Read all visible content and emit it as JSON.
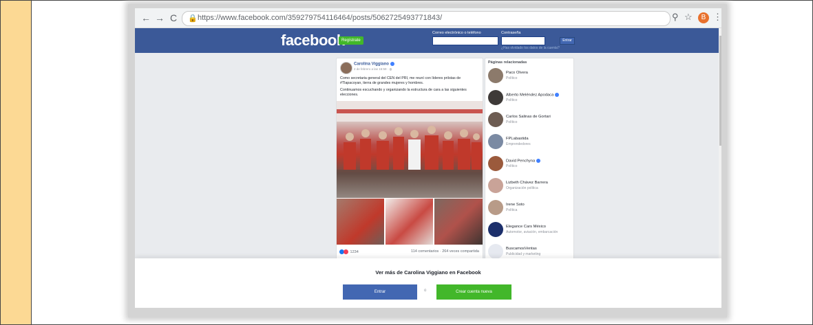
{
  "browser": {
    "url": "https://www.facebook.com/359279754116464/posts/5062725493771843/",
    "profile_initial": "B"
  },
  "facebook": {
    "logo": "facebook",
    "register_label": "Regístrate",
    "email_label": "Correo electrónico o teléfono",
    "password_label": "Contraseña",
    "login_label": "Entrar",
    "forgot_label": "¿Has olvidado los datos de la cuenta?"
  },
  "post": {
    "author": "Carolina Viggiano",
    "date": "2 de febrero a las 15:59 · ",
    "text_1": "Como secretaria general del CEN del PRI, me reuní con líderes priístas de #Tlapacoyan, tierra de grandes mujeres y hombres.",
    "text_2": "Continuamos escuchando y organizando la estructura de cara a las siguientes elecciones.",
    "reaction_count": "1234",
    "counts": "114 comentarios · 264 veces compartida"
  },
  "related": {
    "title": "Páginas relacionadas",
    "items": [
      {
        "name": "Paco Olvera",
        "category": "Político"
      },
      {
        "name": "Alberto Meléndez Apodaca",
        "category": "Político"
      },
      {
        "name": "Carlos Salinas de Gortari",
        "category": "Político"
      },
      {
        "name": "FPLabastida",
        "category": "Emprendedores"
      },
      {
        "name": "David Penchyna",
        "category": "Político"
      },
      {
        "name": "Lizbeth Chávez Barrera",
        "category": "Organización política"
      },
      {
        "name": "Irene Soto",
        "category": "Política"
      },
      {
        "name": "Elegance Cars México",
        "category": "Automotor, aviación, embarcación"
      },
      {
        "name": "BuscamosVentas",
        "category": "Publicidad y marketing"
      }
    ]
  },
  "overlay": {
    "title": "Ver más de Carolina Viggiano en Facebook",
    "login_label": "Entrar",
    "or_label": "o",
    "create_label": "Crear cuenta nueva"
  },
  "colors": {
    "fb_blue": "#3b5998",
    "fb_green": "#42b72a",
    "side_strip": "#fcd994"
  }
}
